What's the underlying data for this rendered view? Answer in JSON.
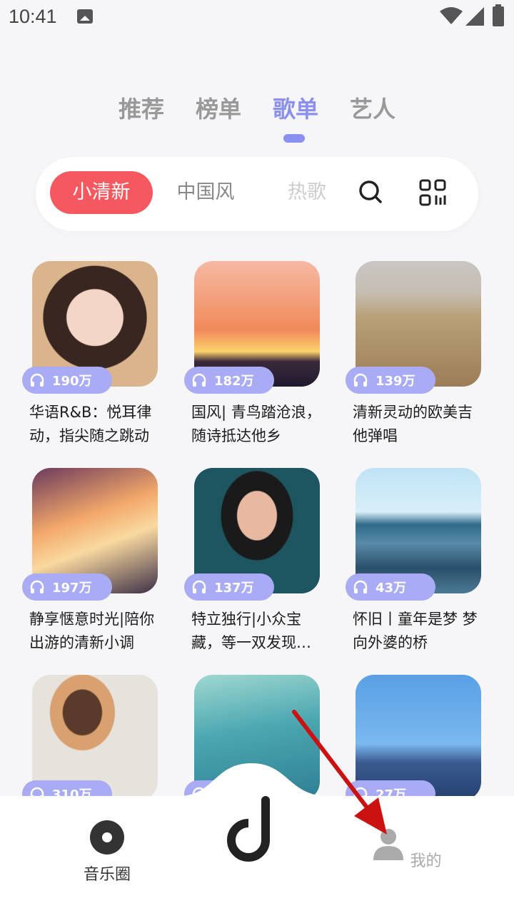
{
  "status": {
    "time": "10:41"
  },
  "tabs": [
    "推荐",
    "榜单",
    "歌单",
    "艺人"
  ],
  "active_tab": "歌单",
  "filters": {
    "chips": [
      "小清新",
      "中国风",
      "热歌"
    ],
    "active": "小清新"
  },
  "playlists": [
    {
      "plays": "190万",
      "title": "华语R&B：悦耳律动，指尖随之跳动"
    },
    {
      "plays": "182万",
      "title": "国风| 青鸟踏沧浪，随诗抵达他乡"
    },
    {
      "plays": "139万",
      "title": "清新灵动的欧美吉他弹唱"
    },
    {
      "plays": "197万",
      "title": "静享惬意时光|陪你出游的清新小调"
    },
    {
      "plays": "137万",
      "title": "特立独行|小众宝藏，等一双发现…"
    },
    {
      "plays": "43万",
      "title": "怀旧丨童年是梦 梦向外婆的桥"
    },
    {
      "plays": "310万",
      "title": ""
    },
    {
      "plays": "",
      "title": ""
    },
    {
      "plays": "27万",
      "title": ""
    }
  ],
  "nav": {
    "music_circle": "音乐圈",
    "mine": "我的"
  },
  "colors": {
    "accent": "#8b8ff0",
    "chip_active": "#f5585f",
    "play_badge": "#a9acf5",
    "annotation_arrow": "#cc1111"
  }
}
